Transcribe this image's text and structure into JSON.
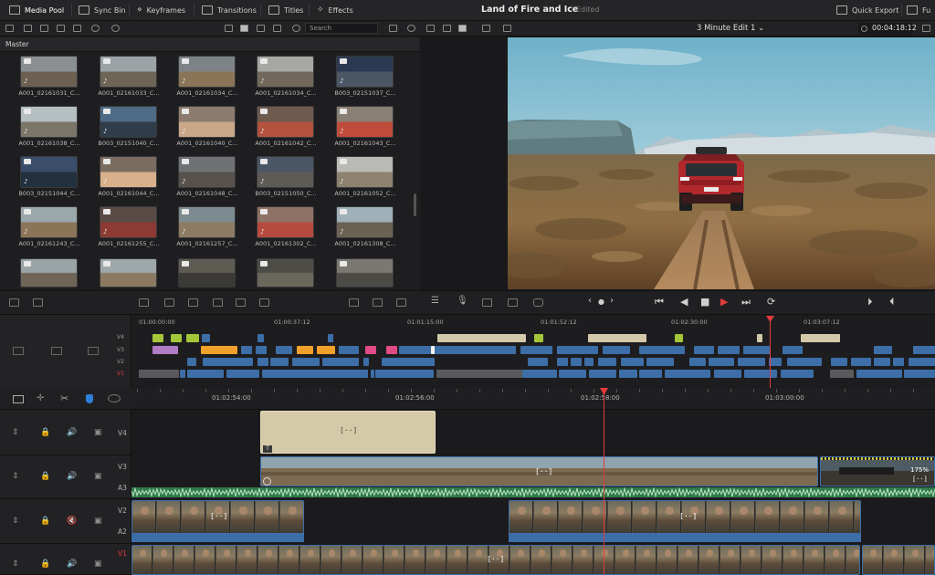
{
  "topbar": {
    "tabs": [
      "Media Pool",
      "Sync Bin",
      "Keyframes",
      "Transitions",
      "Titles",
      "Effects"
    ],
    "project_title": "Land of Fire and Ice",
    "project_status": "Edited",
    "quick_export": "Quick Export",
    "right_cut": "Fu"
  },
  "pool": {
    "search_placeholder": "Search",
    "bin": "Master",
    "clips": [
      "A001_02161031_C...",
      "A001_02161033_C...",
      "A001_02161034_C...",
      "A001_02161034_C...",
      "B003_02151037_C...",
      "A001_02161038_C...",
      "B003_02151040_C...",
      "A001_02161040_C...",
      "A001_02161042_C...",
      "A001_02161043_C...",
      "B003_02151044_C...",
      "A001_02161044_C...",
      "A001_02161048_C...",
      "B003_02151050_C...",
      "A001_02161052_C...",
      "A001_02161243_C...",
      "A001_02161255_C...",
      "A001_02161257_C...",
      "A001_02161302_C...",
      "A001_02161308_C...",
      "",
      "",
      "",
      "",
      ""
    ]
  },
  "viewer": {
    "timeline_name": "3 Minute Edit 1",
    "timecode": "00:04:18:12"
  },
  "mini_timeline": {
    "timecodes": [
      "01:00:00:00",
      "01:00:37:12",
      "01:01:15:00",
      "01:01:52:12",
      "01:02:30:00",
      "01:03:07:12"
    ],
    "tracks": [
      "V4",
      "V3",
      "V2",
      "V1"
    ]
  },
  "ruler": {
    "timecodes": [
      "01:02:54:00",
      "01:02:56:00",
      "01:02:58:00",
      "01:03:00:00"
    ]
  },
  "big_timeline": {
    "tracks": [
      {
        "video": "V4",
        "audio": ""
      },
      {
        "video": "V3",
        "audio": "A3"
      },
      {
        "video": "V2",
        "audio": "A2"
      },
      {
        "video": "V1",
        "audio": ""
      }
    ],
    "title_badge": "T",
    "zoom_percent": "175%",
    "clip_marker": "[··]"
  },
  "colors": {
    "accent_red": "#e23b3b",
    "clip_blue": "#3d6ea8",
    "audio_green": "#3fa35a",
    "title_tan": "#d4c9a8"
  }
}
